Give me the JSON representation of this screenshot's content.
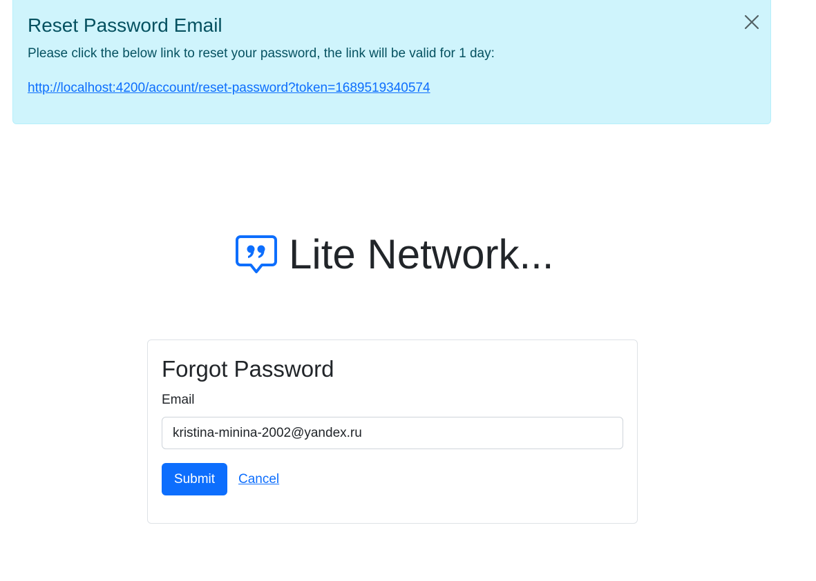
{
  "alert": {
    "title": "Reset Password Email",
    "message": "Please click the below link to reset your password, the link will be valid for 1 day:",
    "link_text": "http://localhost:4200/account/reset-password?token=1689519340574",
    "close_icon": "close-icon"
  },
  "brand": {
    "title": "Lite Network...",
    "icon": "quote-chat-icon",
    "icon_color": "#0d6efd"
  },
  "form": {
    "title": "Forgot Password",
    "email_label": "Email",
    "email_value": "kristina-minina-2002@yandex.ru",
    "submit_label": "Submit",
    "cancel_label": "Cancel"
  },
  "colors": {
    "alert_bg": "#cff4fc",
    "alert_text": "#055160",
    "primary": "#0d6efd"
  }
}
